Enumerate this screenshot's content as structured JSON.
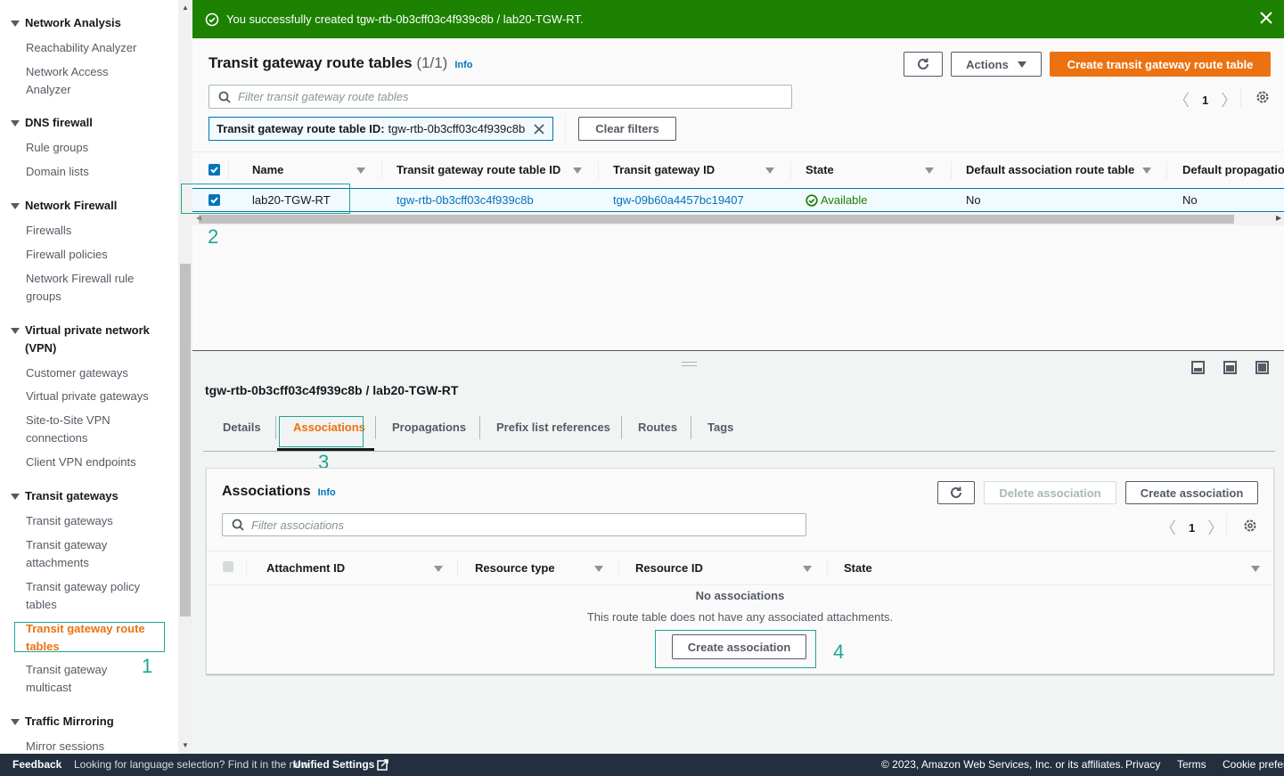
{
  "sidebar": {
    "sections": [
      {
        "label": "Network Analysis",
        "items": [
          "Reachability Analyzer",
          "Network Access Analyzer"
        ]
      },
      {
        "label": "DNS firewall",
        "items": [
          "Rule groups",
          "Domain lists"
        ]
      },
      {
        "label": "Network Firewall",
        "items": [
          "Firewalls",
          "Firewall policies",
          "Network Firewall rule groups"
        ]
      },
      {
        "label": "Virtual private network (VPN)",
        "items": [
          "Customer gateways",
          "Virtual private gateways",
          "Site-to-Site VPN connections",
          "Client VPN endpoints"
        ]
      },
      {
        "label": "Transit gateways",
        "items": [
          "Transit gateways",
          "Transit gateway attachments",
          "Transit gateway policy tables",
          "Transit gateway route tables",
          "Transit gateway multicast"
        ]
      },
      {
        "label": "Traffic Mirroring",
        "items": [
          "Mirror sessions"
        ]
      }
    ],
    "active_item": "Transit gateway route tables"
  },
  "banner": {
    "message": "You successfully created tgw-rtb-0b3cff03c4f939c8b / lab20-TGW-RT.",
    "color": "#1d8102"
  },
  "route_tables": {
    "title": "Transit gateway route tables",
    "count": "(1/1)",
    "info": "Info",
    "actions_label": "Actions",
    "create_label": "Create transit gateway route table",
    "search_placeholder": "Filter transit gateway route tables",
    "filter_token_key": "Transit gateway route table ID:",
    "filter_token_value": "tgw-rtb-0b3cff03c4f939c8b",
    "clear_filters": "Clear filters",
    "page": "1",
    "columns": [
      "Name",
      "Transit gateway route table ID",
      "Transit gateway ID",
      "State",
      "Default association route table",
      "Default propagatio"
    ],
    "rows": [
      {
        "name": "lab20-TGW-RT",
        "rtb_id": "tgw-rtb-0b3cff03c4f939c8b",
        "tgw_id": "tgw-09b60a4457bc19407",
        "state": "Available",
        "default_assoc": "No",
        "default_prop": "No"
      }
    ]
  },
  "details": {
    "title": "tgw-rtb-0b3cff03c4f939c8b / lab20-TGW-RT",
    "tabs": [
      "Details",
      "Associations",
      "Propagations",
      "Prefix list references",
      "Routes",
      "Tags"
    ],
    "active_tab": "Associations"
  },
  "associations": {
    "title": "Associations",
    "info": "Info",
    "delete_label": "Delete association",
    "create_label": "Create association",
    "search_placeholder": "Filter associations",
    "page": "1",
    "columns": [
      "Attachment ID",
      "Resource type",
      "Resource ID",
      "State"
    ],
    "empty_title": "No associations",
    "empty_message": "This route table does not have any associated attachments.",
    "empty_create_label": "Create association"
  },
  "annotations": [
    "1",
    "2",
    "3",
    "4"
  ],
  "footer": {
    "feedback": "Feedback",
    "language_msg": "Looking for language selection? Find it in the new",
    "unified_settings": "Unified Settings",
    "copyright": "© 2023, Amazon Web Services, Inc. or its affiliates.",
    "privacy": "Privacy",
    "terms": "Terms",
    "cookie": "Cookie prefere"
  }
}
